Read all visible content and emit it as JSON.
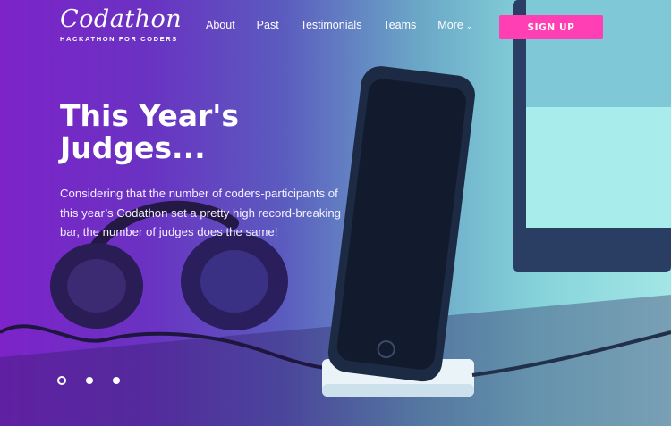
{
  "brand": {
    "name": "Codathon",
    "tagline": "HACKATHON FOR CODERS"
  },
  "nav": {
    "items": [
      {
        "label": "About"
      },
      {
        "label": "Past"
      },
      {
        "label": "Testimonials"
      },
      {
        "label": "Teams"
      },
      {
        "label": "More",
        "icon": "chevron-down-icon"
      }
    ],
    "signup_label": "SIGN UP"
  },
  "hero": {
    "title": "This Year's Judges...",
    "description": "Considering that the number of coders-participants of this year’s Codathon set a pretty high record-breaking bar, the number of judges does the same!"
  },
  "carousel": {
    "slide_count": 3,
    "active_index": 0
  },
  "colors": {
    "accent": "#ff3fb3",
    "gradient_left": "#7d23c9",
    "gradient_right": "#a3e6e6"
  }
}
